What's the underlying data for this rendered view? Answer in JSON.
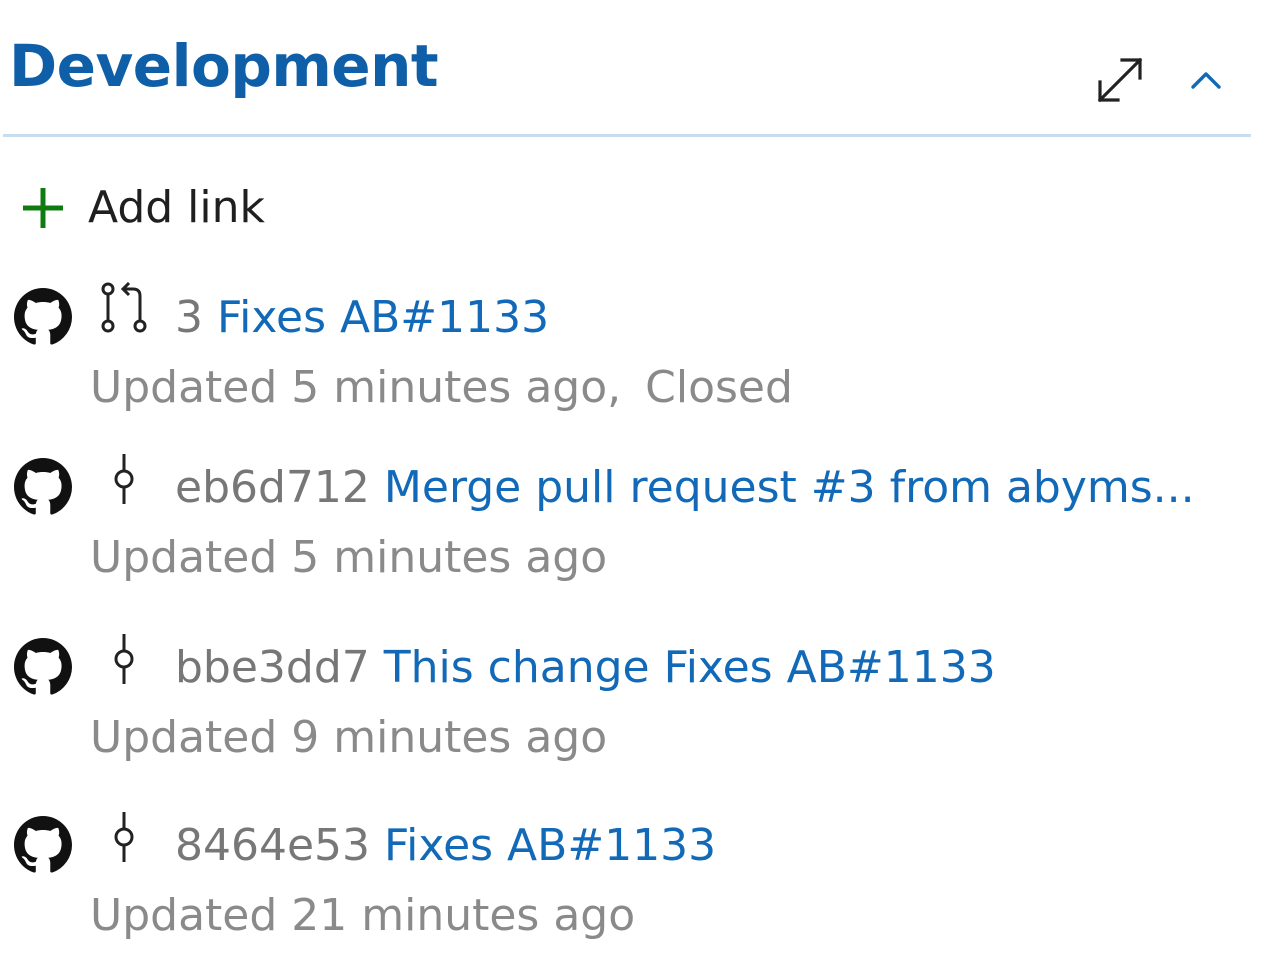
{
  "header": {
    "title": "Development"
  },
  "add_link": {
    "label": "Add link"
  },
  "links": [
    {
      "kind": "pull-request",
      "ref": "3",
      "title": "Fixes AB#1133",
      "updated": "Updated 5 minutes ago,",
      "state": "Closed"
    },
    {
      "kind": "commit",
      "ref": "eb6d712",
      "title": "Merge pull request #3 from abyms...",
      "updated": "Updated 5 minutes ago",
      "state": ""
    },
    {
      "kind": "commit",
      "ref": "bbe3dd7",
      "title": "This change Fixes AB#1133",
      "updated": "Updated 9 minutes ago",
      "state": ""
    },
    {
      "kind": "commit",
      "ref": "8464e53",
      "title": "Fixes AB#1133",
      "updated": "Updated 21 minutes ago",
      "state": ""
    }
  ],
  "icons": {
    "expand": "expand-icon",
    "collapse": "chevron-up-icon",
    "add": "plus-icon",
    "provider": "github-icon",
    "pull_request": "pull-request-icon",
    "commit": "commit-icon"
  },
  "colors": {
    "title": "#0f5fa8",
    "link": "#1169b8",
    "ref": "#777777",
    "meta": "#8a8a8a",
    "divider": "#c7dcef",
    "add": "#107c10"
  }
}
